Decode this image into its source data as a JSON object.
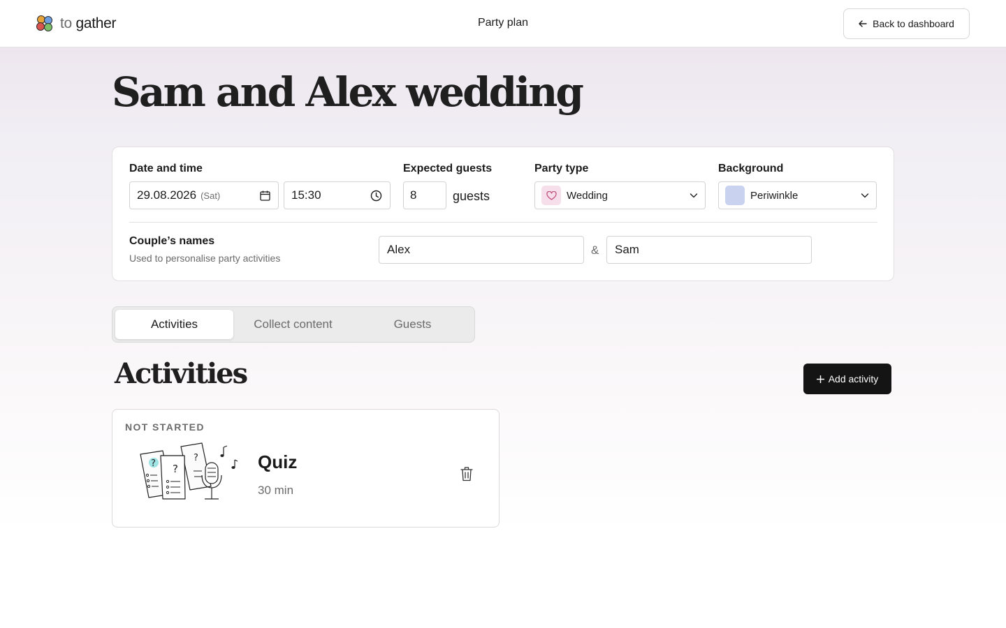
{
  "header": {
    "logo_to": "to",
    "logo_gather": "gather",
    "page_label": "Party plan",
    "back_label": "Back to dashboard"
  },
  "party": {
    "title": "Sam and Alex wedding",
    "date_label": "Date and time",
    "date_value": "29.08.2026",
    "weekday": "(Sat)",
    "time_value": "15:30",
    "guests_label": "Expected guests",
    "guests_value": "8",
    "guests_unit": "guests",
    "type_label": "Party type",
    "type_value": "Wedding",
    "background_label": "Background",
    "background_value": "Periwinkle",
    "couple_label": "Couple’s names",
    "couple_sub": "Used to personalise party activities",
    "name1": "Alex",
    "amp": "&",
    "name2": "Sam"
  },
  "tabs": [
    {
      "label": "Activities",
      "active": true
    },
    {
      "label": "Collect content",
      "active": false
    },
    {
      "label": "Guests",
      "active": false
    }
  ],
  "activities_section": {
    "title": "Activities",
    "add_label": "Add activity"
  },
  "activities": [
    {
      "status": "NOT STARTED",
      "name": "Quiz",
      "duration": "30 min"
    }
  ],
  "colors": {
    "periwinkle": "#c9d3ef",
    "wedding_swatch": "#f6dfea",
    "heart": "#c0527e",
    "add_button": "#141414"
  },
  "icons": {
    "back": "arrow-left-icon",
    "calendar": "calendar-icon",
    "clock": "clock-icon",
    "heart": "heart-icon",
    "chevron": "chevron-down-icon",
    "plus": "plus-icon",
    "trash": "trash-icon"
  }
}
